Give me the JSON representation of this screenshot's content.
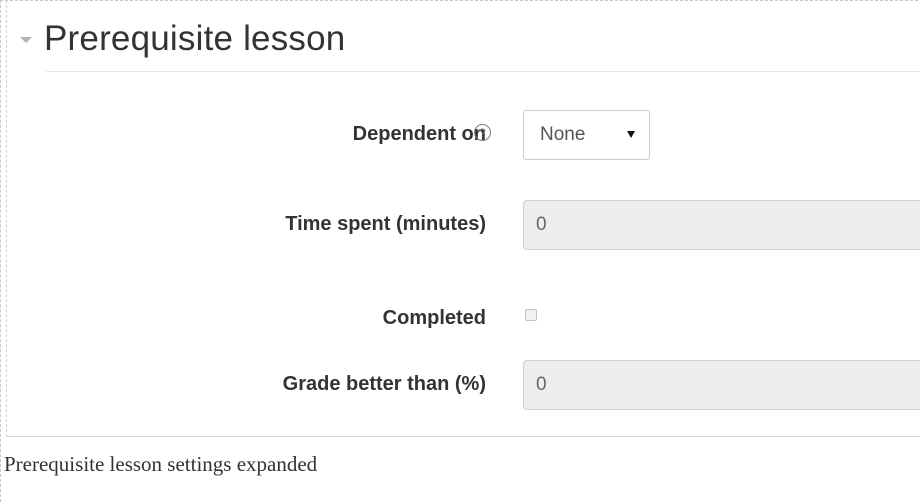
{
  "fieldset": {
    "title": "Prerequisite lesson"
  },
  "fields": {
    "dependent_on": {
      "label": "Dependent on",
      "help_icon": "help-icon",
      "selected": "None"
    },
    "time_spent": {
      "label": "Time spent (minutes)",
      "value": "0"
    },
    "completed": {
      "label": "Completed",
      "checked": false
    },
    "grade_better_than": {
      "label": "Grade better than (%)",
      "value": "0"
    }
  },
  "caption": "Prerequisite lesson settings expanded"
}
